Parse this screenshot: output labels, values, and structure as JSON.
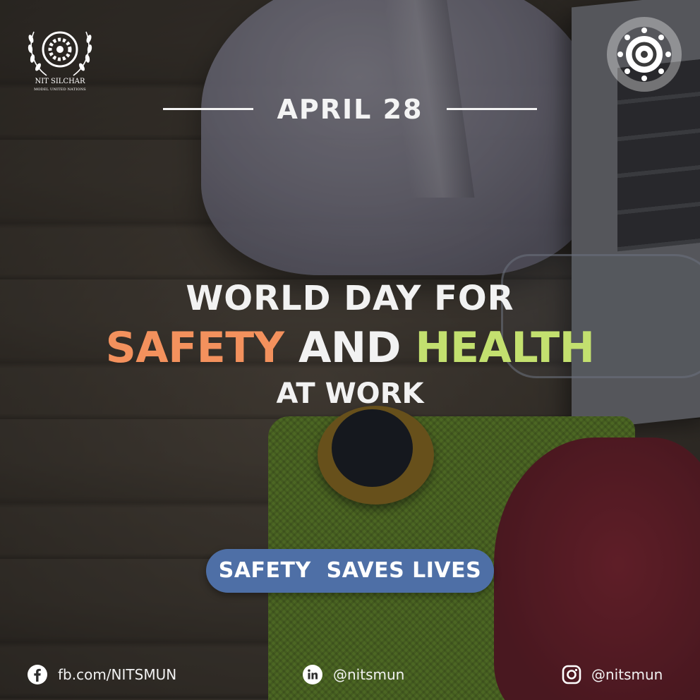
{
  "logos": {
    "left": {
      "name": "NIT SILCHAR",
      "subtitle": "MODEL UNITED NATIONS"
    },
    "right": {
      "name": "National Institute of Technology Silchar seal"
    }
  },
  "header": {
    "date": "APRIL 28"
  },
  "headline": {
    "line1": "WORLD DAY FOR",
    "line2_part1": "SAFETY",
    "line2_part2": "AND",
    "line2_part3": "HEALTH",
    "line3": "AT WORK"
  },
  "tagline": "SAFETY  SAVES LIVES",
  "social": {
    "facebook": {
      "icon": "facebook-icon",
      "text": "fb.com/NITSMUN"
    },
    "linkedin": {
      "icon": "linkedin-icon",
      "text": "@nitsmun"
    },
    "instagram": {
      "icon": "instagram-icon",
      "text": "@nitsmun"
    }
  },
  "colors": {
    "accent_orange": "#f3915d",
    "accent_lime": "#c3e06f",
    "pill_blue": "#4e6fa6"
  }
}
